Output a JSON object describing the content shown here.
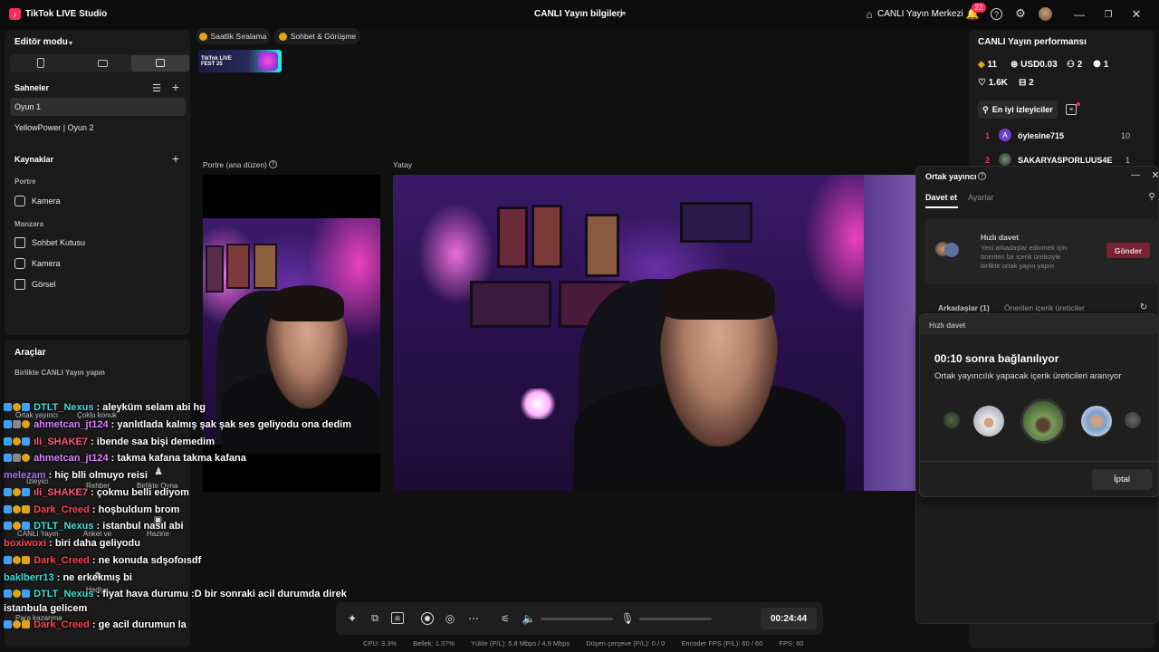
{
  "app": {
    "title": "TikTok LIVE Studio",
    "center_title": "CANLI Yayın bilgileri",
    "live_center": "CANLI Yayın Merkezi",
    "notif_count": "22"
  },
  "colors": {
    "accent": "#fe2c55",
    "teal": "#25f4ee",
    "bg": "#101010",
    "panel": "#1a1a1a"
  },
  "left": {
    "editor_mode": "Editör modu",
    "scenes_title": "Sahneler",
    "scenes": [
      "Oyun 1",
      "YellowPower | Oyun 2"
    ],
    "sources_title": "Kaynaklar",
    "group_portrait": "Portre",
    "portrait_items": [
      "Kamera"
    ],
    "group_landscape": "Manzara",
    "landscape_items": [
      "Sohbet Kutusu",
      "Kamera",
      "Görsel"
    ],
    "tools_title": "Araçlar",
    "tools_subtitle": "Birlikte CANLI Yayın yapın",
    "tools_partial": [
      "Ortak yayıncı",
      "Çoklu konuk",
      "İzleyici",
      "Rehber",
      "Birlikte Oyna",
      "CANLI Yayın",
      "Anket ve",
      "Hazine",
      "Hediye",
      "Para kazanma"
    ]
  },
  "center": {
    "tab_ranking": "Saatlik Sıralama",
    "tab_chat": "Sohbet & Görüşme",
    "banner": "TikTok LIVE FEST 25",
    "portrait_label": "Portre (ana düzen)",
    "landscape_label": "Yatay"
  },
  "chat": [
    {
      "user": "DTLT_Nexus",
      "msg": ": aleyküm selam abi hg",
      "color": "#3ee0d8"
    },
    {
      "user": "ahmetcan_jt124",
      "msg": ": yanlıtlada kalmış şak şak ses geliyodu ona dedim",
      "color": "#d883ff"
    },
    {
      "user": "ıli_SHAKE7",
      "msg": ": ibende saa bişi demedim",
      "color": "#ff5a7a"
    },
    {
      "user": "ahmetcan_jt124",
      "msg": ": takma kafana takma kafana",
      "color": "#d883ff"
    },
    {
      "user": "melezam",
      "msg": ": hiç blli olmuyo reisi",
      "color": "#b070ff"
    },
    {
      "user": "ıli_SHAKE7",
      "msg": ": çokmu belli ediyom",
      "color": "#ff5a7a"
    },
    {
      "user": "Dark_Creed",
      "msg": ": hoşbuldum brom",
      "color": "#ff4455"
    },
    {
      "user": "DTLT_Nexus",
      "msg": ": istanbul nasıl abi",
      "color": "#3ee0d8"
    },
    {
      "user": "boxiwoxi",
      "msg": ": biri daha geliyodu",
      "color": "#ff4455"
    },
    {
      "user": "Dark_Creed",
      "msg": ": ne konuda sdşofoısdf",
      "color": "#ff4455"
    },
    {
      "user": "baklberr13",
      "msg": ": ne erkekmış bi",
      "color": "#3ee0d8"
    },
    {
      "user": "DTLT_Nexus",
      "msg": ": fiyat hava durumu :D bir sonraki acil durumda direk",
      "color": "#3ee0d8"
    },
    {
      "user": "",
      "msg": "istanbula gelicem",
      "color": "#ffffff"
    },
    {
      "user": "Dark_Creed",
      "msg": ": ge acil durumun la",
      "color": "#ff4455"
    }
  ],
  "control": {
    "timer": "00:24:44"
  },
  "status": {
    "cpu": "CPU: 3.3%",
    "memory": "Bellek: 1.37%",
    "upload": "Yükle (P/L): 5.8 Mbps / 4.9 Mbps",
    "dropped": "Düşen çerçeve (P/L): 0 / 0",
    "encoder": "Encoder FPS (P/L): 60 / 60",
    "fps": "FPS: 60"
  },
  "right": {
    "perf_title": "CANLI Yayın performansı",
    "diamonds": "11",
    "usd": "USD0.03",
    "users": "2",
    "follows": "1",
    "likes": "1.6K",
    "gifts": "2",
    "top_viewers": "En iyi izleyiciler",
    "viewers": [
      {
        "rank": "1",
        "name": "öylesine715",
        "score": "10",
        "initial": "A"
      },
      {
        "rank": "2",
        "name": "SAKARYASPORLUUS4E",
        "score": "1"
      }
    ]
  },
  "cohost": {
    "title": "Ortak yayıncı",
    "tab_invite": "Davet et",
    "tab_settings": "Ayarlar",
    "quick_invite_title": "Hızlı davet",
    "quick_invite_desc": [
      "Yeni arkadaşlar edinmek için",
      "önerilen bir içerik üreticiyle",
      "birlikte ortak yayın yapın"
    ],
    "send": "Gönder",
    "friends_tab": "Arkadaşlar (1)",
    "suggested_tab": "Önerilen içerik üreticiler"
  },
  "quick_dialog": {
    "title": "Hızlı davet",
    "countdown": "00:10 sonra bağlanılıyor",
    "subtitle": "Ortak yayıncılık yapacak içerik üreticileri aranıyor",
    "cancel": "İptal"
  }
}
